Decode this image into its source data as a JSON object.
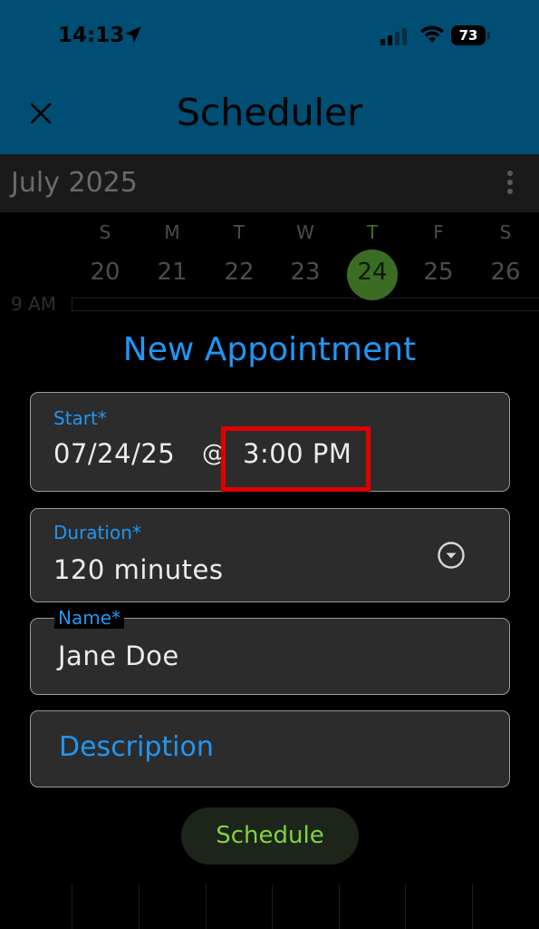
{
  "status_bar": {
    "time": "14:13",
    "battery": "73"
  },
  "header": {
    "title": "Scheduler",
    "close_icon": "close-icon",
    "background_color": "#004e73"
  },
  "calendar": {
    "month": "July 2025",
    "days": [
      {
        "letter": "S",
        "num": "20"
      },
      {
        "letter": "M",
        "num": "21"
      },
      {
        "letter": "T",
        "num": "22"
      },
      {
        "letter": "W",
        "num": "23"
      },
      {
        "letter": "T",
        "num": "24",
        "today": true
      },
      {
        "letter": "F",
        "num": "25"
      },
      {
        "letter": "S",
        "num": "26"
      }
    ],
    "first_hour_label": "9 AM",
    "today_color": "#3b6c23"
  },
  "dialog": {
    "title": "New Appointment",
    "start": {
      "label": "Start*",
      "date": "07/24/25",
      "separator": "@",
      "time": "3:00 PM"
    },
    "duration": {
      "label": "Duration*",
      "value": "120 minutes",
      "icon": "chevron-down-circle-icon"
    },
    "name": {
      "label": "Name*",
      "value": "Jane Doe"
    },
    "description": {
      "placeholder": "Description"
    },
    "schedule_button": "Schedule",
    "accent_color": "#2196f3",
    "highlight_color": "#e00000"
  }
}
